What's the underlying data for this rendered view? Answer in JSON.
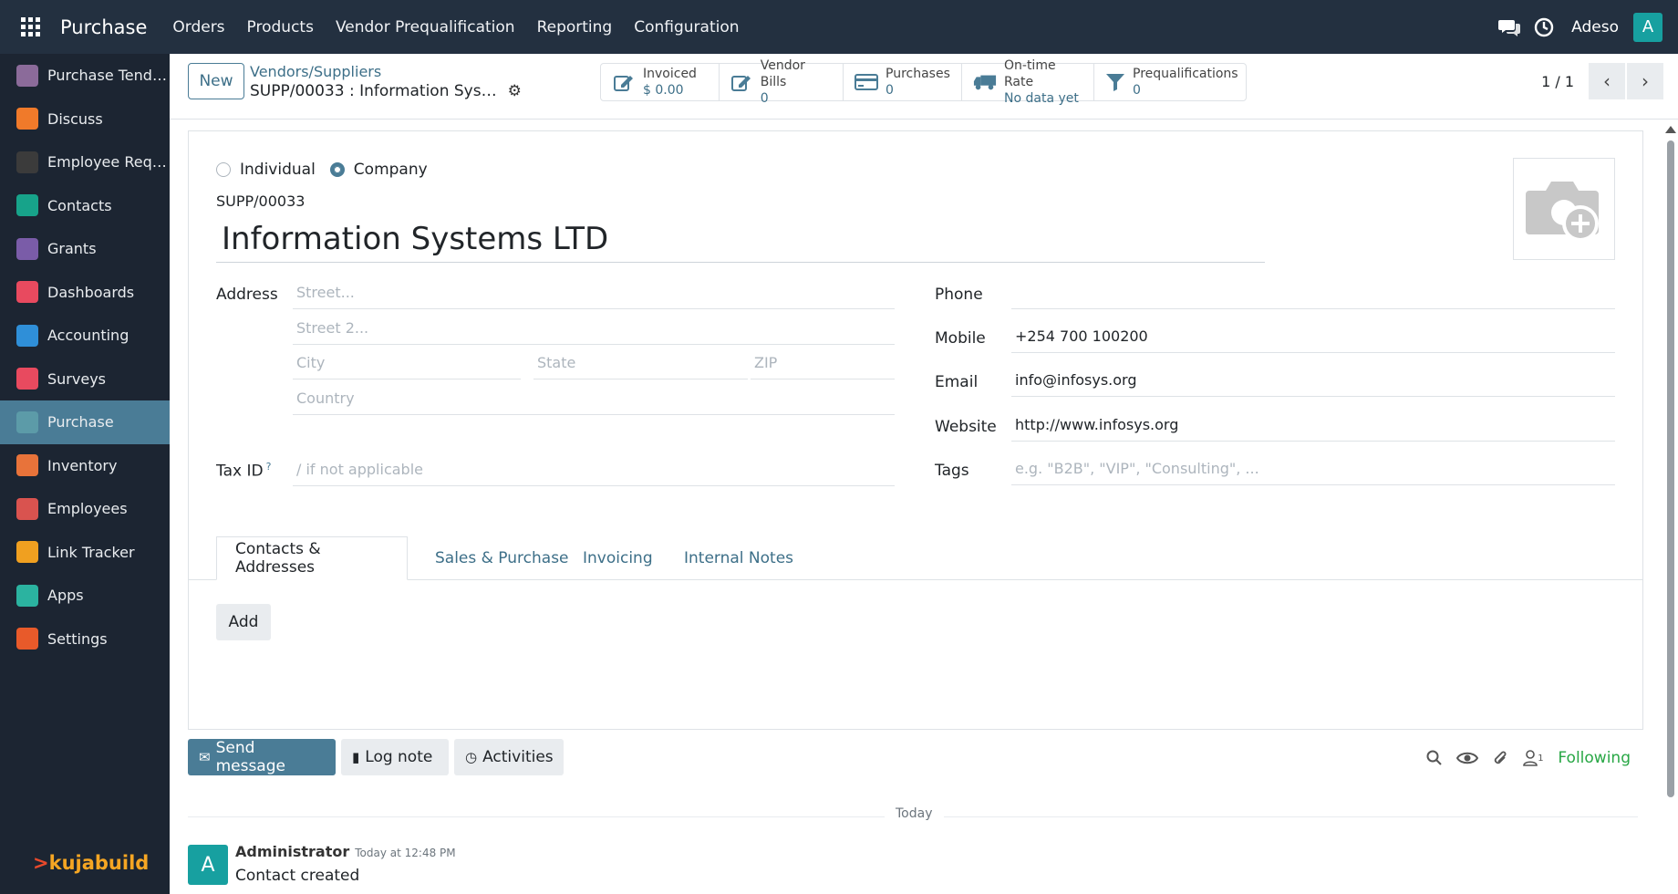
{
  "topbar": {
    "app_name": "Purchase",
    "menu": [
      "Orders",
      "Products",
      "Vendor Prequalification",
      "Reporting",
      "Configuration"
    ],
    "user": "Adeso",
    "avatar_letter": "A"
  },
  "sidebar": {
    "items": [
      {
        "label": "Purchase Tend…",
        "icon": "purchase-tender-icon",
        "color": "#8b6b9a"
      },
      {
        "label": "Discuss",
        "icon": "discuss-icon",
        "color": "#f07a2a"
      },
      {
        "label": "Employee Req…",
        "icon": "employee-request-icon",
        "color": "#3b3b3b"
      },
      {
        "label": "Contacts",
        "icon": "contacts-icon",
        "color": "#17a38a"
      },
      {
        "label": "Grants",
        "icon": "grants-icon",
        "color": "#7a5ca8"
      },
      {
        "label": "Dashboards",
        "icon": "dashboards-icon",
        "color": "#e84a5f"
      },
      {
        "label": "Accounting",
        "icon": "accounting-icon",
        "color": "#2f8fd8"
      },
      {
        "label": "Surveys",
        "icon": "surveys-icon",
        "color": "#e84a5f"
      },
      {
        "label": "Purchase",
        "icon": "purchase-icon",
        "color": "#5c9ba8",
        "active": true
      },
      {
        "label": "Inventory",
        "icon": "inventory-icon",
        "color": "#e8733a"
      },
      {
        "label": "Employees",
        "icon": "employees-icon",
        "color": "#d9534f"
      },
      {
        "label": "Link Tracker",
        "icon": "link-tracker-icon",
        "color": "#f0a020"
      },
      {
        "label": "Apps",
        "icon": "apps-icon",
        "color": "#2bb3a0"
      },
      {
        "label": "Settings",
        "icon": "settings-icon",
        "color": "#e85a2a"
      }
    ],
    "logo_text": "kujabuild"
  },
  "control": {
    "new_label": "New",
    "breadcrumb_parent": "Vendors/Suppliers",
    "breadcrumb_current": "SUPP/00033 : Information Sys…",
    "stats": [
      {
        "label": "Invoiced",
        "value": "$ 0.00",
        "icon": "invoice-edit-icon"
      },
      {
        "label": "Vendor Bills",
        "value": "0",
        "icon": "vendor-bills-edit-icon"
      },
      {
        "label": "Purchases",
        "value": "0",
        "icon": "credit-card-icon"
      },
      {
        "label": "On-time Rate",
        "value": "No data yet",
        "icon": "truck-icon"
      },
      {
        "label": "Prequalifications",
        "value": "0",
        "icon": "filter-icon"
      }
    ],
    "pager": "1 / 1"
  },
  "form": {
    "type_options": [
      "Individual",
      "Company"
    ],
    "type_selected": "Company",
    "reference": "SUPP/00033",
    "name": "Information Systems LTD",
    "address_label": "Address",
    "street_ph": "Street...",
    "street2_ph": "Street 2...",
    "city_ph": "City",
    "state_ph": "State",
    "zip_ph": "ZIP",
    "country_ph": "Country",
    "taxid_label": "Tax ID",
    "taxid_help": "?",
    "taxid_ph": "/ if not applicable",
    "phone_label": "Phone",
    "phone_value": "",
    "mobile_label": "Mobile",
    "mobile_value": "+254 700 100200",
    "email_label": "Email",
    "email_value": "info@infosys.org",
    "website_label": "Website",
    "website_value": "http://www.infosys.org",
    "tags_label": "Tags",
    "tags_ph": "e.g. \"B2B\", \"VIP\", \"Consulting\", ..."
  },
  "tabs": [
    "Contacts & Addresses",
    "Sales & Purchase",
    "Invoicing",
    "Internal Notes"
  ],
  "tab_active": "Contacts & Addresses",
  "add_label": "Add",
  "chatter": {
    "send_message": "Send message",
    "log_note": "Log note",
    "activities": "Activities",
    "followers_count": "1",
    "following": "Following",
    "today": "Today",
    "message": {
      "avatar": "A",
      "author": "Administrator",
      "time": "Today at 12:48 PM",
      "body": "Contact created"
    }
  }
}
